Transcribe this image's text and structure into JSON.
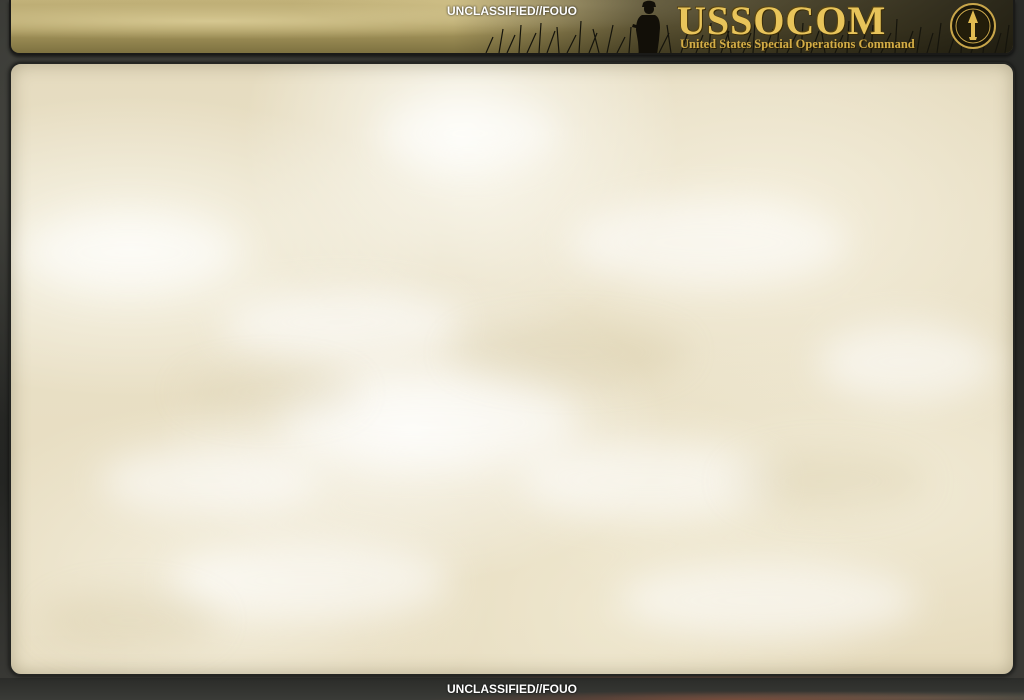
{
  "classification": {
    "top": "UNCLASSIFIED//FOUO",
    "bottom": "UNCLASSIFIED//FOUO"
  },
  "header": {
    "title": "USSOCOM",
    "subtitle": "United States Special Operations Command",
    "logo_icon": "ussocom-seal-icon",
    "decor_icon": "soldier-silhouette-icon"
  },
  "colors": {
    "brand_gold": "#e8c45a",
    "banner_khaki": "#a8985e",
    "panel_parchment": "#e9e0c6"
  }
}
